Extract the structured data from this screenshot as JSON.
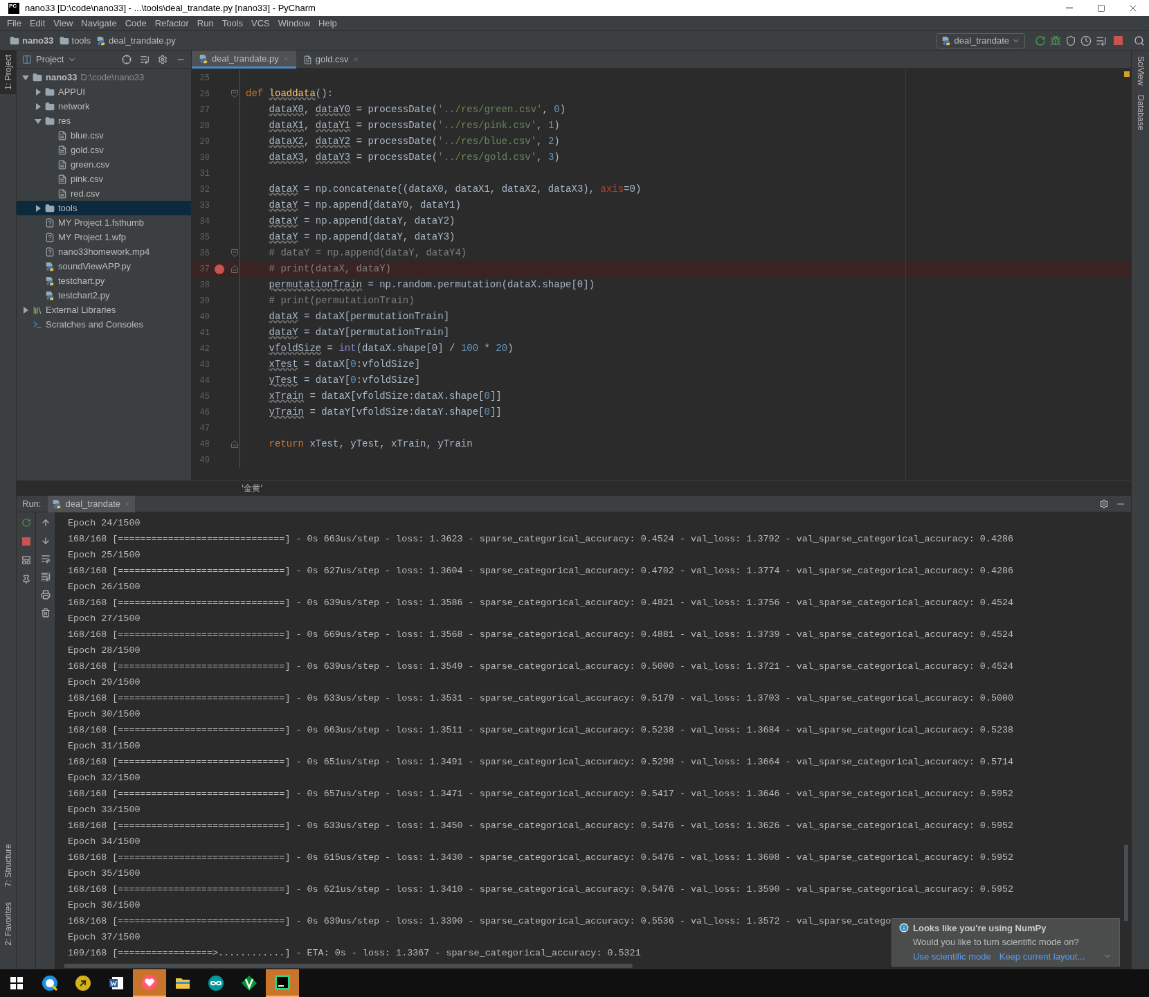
{
  "window": {
    "app_icon_text": "PC",
    "title": "nano33 [D:\\code\\nano33] - ...\\tools\\deal_trandate.py [nano33] - PyCharm"
  },
  "menu": [
    "File",
    "Edit",
    "View",
    "Navigate",
    "Code",
    "Refactor",
    "Run",
    "Tools",
    "VCS",
    "Window",
    "Help"
  ],
  "breadcrumb": [
    {
      "label": "nano33",
      "kind": "project"
    },
    {
      "label": "tools",
      "kind": "folder"
    },
    {
      "label": "deal_trandate.py",
      "kind": "python"
    }
  ],
  "run_config": {
    "label": "deal_trandate"
  },
  "left_stripe": [
    {
      "label": "1: Project",
      "selected": true
    },
    {
      "label": "7: Structure",
      "selected": false
    },
    {
      "label": "2: Favorites",
      "selected": false
    }
  ],
  "right_stripe": [
    "SciView",
    "Database"
  ],
  "project": {
    "title": "Project",
    "tree": [
      {
        "name": "nano33",
        "path": "D:\\code\\nano33",
        "kind": "project",
        "expanded": true,
        "selected": false,
        "children": [
          {
            "name": "APPUI",
            "kind": "module",
            "expanded": false,
            "selected": false
          },
          {
            "name": "network",
            "kind": "module",
            "expanded": false,
            "selected": false
          },
          {
            "name": "res",
            "kind": "module",
            "expanded": true,
            "selected": false,
            "children": [
              {
                "name": "blue.csv",
                "kind": "text",
                "selected": false
              },
              {
                "name": "gold.csv",
                "kind": "text",
                "selected": false
              },
              {
                "name": "green.csv",
                "kind": "text",
                "selected": false
              },
              {
                "name": "pink.csv",
                "kind": "text",
                "selected": false
              },
              {
                "name": "red.csv",
                "kind": "text",
                "selected": false
              }
            ]
          },
          {
            "name": "tools",
            "kind": "module",
            "expanded": false,
            "selected": true
          },
          {
            "name": "MY Project 1.fsthumb",
            "kind": "unknown",
            "selected": false
          },
          {
            "name": "MY Project 1.wfp",
            "kind": "unknown",
            "selected": false
          },
          {
            "name": "nano33homework.mp4",
            "kind": "unknown",
            "selected": false
          },
          {
            "name": "soundViewAPP.py",
            "kind": "python",
            "selected": false
          },
          {
            "name": "testchart.py",
            "kind": "python",
            "selected": false
          },
          {
            "name": "testchart2.py",
            "kind": "python",
            "selected": false
          }
        ]
      },
      {
        "name": "External Libraries",
        "kind": "library",
        "expanded": false,
        "selected": false
      },
      {
        "name": "Scratches and Consoles",
        "kind": "scratches",
        "selected": false
      }
    ]
  },
  "editor": {
    "tabs": [
      {
        "label": "deal_trandate.py",
        "kind": "python",
        "selected": true
      },
      {
        "label": "gold.csv",
        "kind": "text",
        "selected": false
      }
    ],
    "lines": [
      {
        "number": "25",
        "kind": "plain",
        "breakpoint": false
      },
      {
        "number": "26",
        "kind": "foldstart",
        "breakpoint": false,
        "tokens": [
          {
            "text": "def ",
            "kind": "kw"
          },
          {
            "text": "loaddata",
            "kind": "fn"
          },
          {
            "text": "():"
          }
        ],
        "children": [
          {
            "number": "27",
            "kind": "plain",
            "breakpoint": false,
            "tokens": [
              {
                "text": "dataX0",
                "kind": "var"
              },
              {
                "text": ", "
              },
              {
                "text": "dataY0",
                "kind": "var"
              },
              {
                "text": " = processDate("
              },
              {
                "text": "'../res/green.csv'",
                "kind": "str"
              },
              {
                "text": ", "
              },
              {
                "text": "0",
                "kind": "num"
              },
              {
                "text": ")"
              }
            ]
          },
          {
            "number": "28",
            "kind": "plain",
            "breakpoint": false,
            "tokens": [
              {
                "text": "dataX1",
                "kind": "var"
              },
              {
                "text": ", "
              },
              {
                "text": "dataY1",
                "kind": "var"
              },
              {
                "text": " = processDate("
              },
              {
                "text": "'../res/pink.csv'",
                "kind": "str"
              },
              {
                "text": ", "
              },
              {
                "text": "1",
                "kind": "num"
              },
              {
                "text": ")"
              }
            ]
          },
          {
            "number": "29",
            "kind": "plain",
            "breakpoint": false,
            "tokens": [
              {
                "text": "dataX2",
                "kind": "var"
              },
              {
                "text": ", "
              },
              {
                "text": "dataY2",
                "kind": "var"
              },
              {
                "text": " = processDate("
              },
              {
                "text": "'../res/blue.csv'",
                "kind": "str"
              },
              {
                "text": ", "
              },
              {
                "text": "2",
                "kind": "num"
              },
              {
                "text": ")"
              }
            ]
          },
          {
            "number": "30",
            "kind": "plain",
            "breakpoint": false,
            "tokens": [
              {
                "text": "dataX3",
                "kind": "var"
              },
              {
                "text": ", "
              },
              {
                "text": "dataY3",
                "kind": "var"
              },
              {
                "text": " = processDate("
              },
              {
                "text": "'../res/gold.csv'",
                "kind": "str"
              },
              {
                "text": ", "
              },
              {
                "text": "3",
                "kind": "num"
              },
              {
                "text": ")"
              }
            ]
          },
          {
            "number": "31",
            "kind": "plain",
            "breakpoint": false
          },
          {
            "number": "32",
            "kind": "plain",
            "breakpoint": false,
            "tokens": [
              {
                "text": "dataX",
                "kind": "var"
              },
              {
                "text": " = np.concatenate((dataX0, dataX1, dataX2, dataX3), "
              },
              {
                "text": "axis",
                "kind": "param"
              },
              {
                "text": "=0)"
              }
            ]
          },
          {
            "number": "33",
            "kind": "plain",
            "breakpoint": false,
            "tokens": [
              {
                "text": "dataY",
                "kind": "var"
              },
              {
                "text": " = np.append(dataY0, dataY1)"
              }
            ]
          },
          {
            "number": "34",
            "kind": "plain",
            "breakpoint": false,
            "tokens": [
              {
                "text": "dataY",
                "kind": "var"
              },
              {
                "text": " = np.append(dataY, dataY2)"
              }
            ]
          },
          {
            "number": "35",
            "kind": "plain",
            "breakpoint": false,
            "tokens": [
              {
                "text": "dataY",
                "kind": "var"
              },
              {
                "text": " = np.append(dataY, dataY3)"
              }
            ]
          },
          {
            "number": "36",
            "kind": "foldstart",
            "breakpoint": false,
            "tokens": [
              {
                "text": "# dataY = np.append(dataY, dataY4)",
                "kind": "cm"
              }
            ]
          },
          {
            "number": "37",
            "kind": "foldend",
            "breakpoint": true,
            "tokens": [
              {
                "text": "# print(dataX, dataY)",
                "kind": "cm"
              }
            ]
          },
          {
            "number": "38",
            "kind": "plain",
            "breakpoint": false,
            "tokens": [
              {
                "text": "permutationTrain",
                "kind": "var"
              },
              {
                "text": " = np.random.permutation(dataX.shape[0])"
              }
            ]
          },
          {
            "number": "39",
            "kind": "plain",
            "breakpoint": false,
            "tokens": [
              {
                "text": "# print(permutationTrain)",
                "kind": "cm"
              }
            ]
          },
          {
            "number": "40",
            "kind": "plain",
            "breakpoint": false,
            "tokens": [
              {
                "text": "dataX",
                "kind": "var"
              },
              {
                "text": " = dataX[permutationTrain]"
              }
            ]
          },
          {
            "number": "41",
            "kind": "plain",
            "breakpoint": false,
            "tokens": [
              {
                "text": "dataY",
                "kind": "var"
              },
              {
                "text": " = dataY[permutationTrain]"
              }
            ]
          },
          {
            "number": "42",
            "kind": "plain",
            "breakpoint": false,
            "tokens": [
              {
                "text": "vfoldSize",
                "kind": "var"
              },
              {
                "text": " = "
              },
              {
                "text": "int",
                "kind": "builtin"
              },
              {
                "text": "(dataX.shape[0] / "
              },
              {
                "text": "100",
                "kind": "num"
              },
              {
                "text": " * "
              },
              {
                "text": "20",
                "kind": "num"
              },
              {
                "text": ")"
              }
            ]
          },
          {
            "number": "43",
            "kind": "plain",
            "breakpoint": false,
            "tokens": [
              {
                "text": "xTest",
                "kind": "var"
              },
              {
                "text": " = dataX["
              },
              {
                "text": "0",
                "kind": "num"
              },
              {
                "text": ":vfoldSize]"
              }
            ]
          },
          {
            "number": "44",
            "kind": "plain",
            "breakpoint": false,
            "tokens": [
              {
                "text": "yTest",
                "kind": "var"
              },
              {
                "text": " = dataY["
              },
              {
                "text": "0",
                "kind": "num"
              },
              {
                "text": ":vfoldSize]"
              }
            ]
          },
          {
            "number": "45",
            "kind": "plain",
            "breakpoint": false,
            "tokens": [
              {
                "text": "xTrain",
                "kind": "var"
              },
              {
                "text": " = dataX[vfoldSize:dataX.shape["
              },
              {
                "text": "0",
                "kind": "num"
              },
              {
                "text": "]]"
              }
            ]
          },
          {
            "number": "46",
            "kind": "plain",
            "breakpoint": false,
            "tokens": [
              {
                "text": "yTrain",
                "kind": "var"
              },
              {
                "text": " = dataY[vfoldSize:dataY.shape["
              },
              {
                "text": "0",
                "kind": "num"
              },
              {
                "text": "]]"
              }
            ]
          },
          {
            "number": "47",
            "kind": "plain",
            "breakpoint": false
          },
          {
            "number": "48",
            "kind": "foldend",
            "breakpoint": false,
            "tokens": [
              {
                "text": "return",
                "kind": "kw"
              },
              {
                "text": " xTest, yTest, xTrain, yTrain"
              }
            ]
          }
        ]
      },
      {
        "number": "49",
        "kind": "plain",
        "breakpoint": false
      }
    ],
    "status": "'金黄'"
  },
  "run": {
    "label": "Run:",
    "tab": "deal_trandate",
    "lines": [
      "Epoch 24/1500",
      "168/168 [==============================] - 0s 663us/step - loss: 1.3623 - sparse_categorical_accuracy: 0.4524 - val_loss: 1.3792 - val_sparse_categorical_accuracy: 0.4286",
      "Epoch 25/1500",
      "168/168 [==============================] - 0s 627us/step - loss: 1.3604 - sparse_categorical_accuracy: 0.4702 - val_loss: 1.3774 - val_sparse_categorical_accuracy: 0.4286",
      "Epoch 26/1500",
      "168/168 [==============================] - 0s 639us/step - loss: 1.3586 - sparse_categorical_accuracy: 0.4821 - val_loss: 1.3756 - val_sparse_categorical_accuracy: 0.4524",
      "Epoch 27/1500",
      "168/168 [==============================] - 0s 669us/step - loss: 1.3568 - sparse_categorical_accuracy: 0.4881 - val_loss: 1.3739 - val_sparse_categorical_accuracy: 0.4524",
      "Epoch 28/1500",
      "168/168 [==============================] - 0s 639us/step - loss: 1.3549 - sparse_categorical_accuracy: 0.5000 - val_loss: 1.3721 - val_sparse_categorical_accuracy: 0.4524",
      "Epoch 29/1500",
      "168/168 [==============================] - 0s 633us/step - loss: 1.3531 - sparse_categorical_accuracy: 0.5179 - val_loss: 1.3703 - val_sparse_categorical_accuracy: 0.5000",
      "Epoch 30/1500",
      "168/168 [==============================] - 0s 663us/step - loss: 1.3511 - sparse_categorical_accuracy: 0.5238 - val_loss: 1.3684 - val_sparse_categorical_accuracy: 0.5238",
      "Epoch 31/1500",
      "168/168 [==============================] - 0s 651us/step - loss: 1.3491 - sparse_categorical_accuracy: 0.5298 - val_loss: 1.3664 - val_sparse_categorical_accuracy: 0.5714",
      "Epoch 32/1500",
      "168/168 [==============================] - 0s 657us/step - loss: 1.3471 - sparse_categorical_accuracy: 0.5417 - val_loss: 1.3646 - val_sparse_categorical_accuracy: 0.5952",
      "Epoch 33/1500",
      "168/168 [==============================] - 0s 633us/step - loss: 1.3450 - sparse_categorical_accuracy: 0.5476 - val_loss: 1.3626 - val_sparse_categorical_accuracy: 0.5952",
      "Epoch 34/1500",
      "168/168 [==============================] - 0s 615us/step - loss: 1.3430 - sparse_categorical_accuracy: 0.5476 - val_loss: 1.3608 - val_sparse_categorical_accuracy: 0.5952",
      "Epoch 35/1500",
      "168/168 [==============================] - 0s 621us/step - loss: 1.3410 - sparse_categorical_accuracy: 0.5476 - val_loss: 1.3590 - val_sparse_categorical_accuracy: 0.5952",
      "Epoch 36/1500",
      "168/168 [==============================] - 0s 639us/step - loss: 1.3390 - sparse_categorical_accuracy: 0.5536 - val_loss: 1.3572 - val_sparse_catego",
      "Epoch 37/1500",
      "109/168 [=================>............] - ETA: 0s - loss: 1.3367 - sparse_categorical_accuracy: 0.5321"
    ]
  },
  "notification": {
    "title": "Looks like you're using NumPy",
    "body": "Would you like to turn scientific mode on?",
    "links": [
      "Use scientific mode",
      "Keep current layout..."
    ]
  },
  "taskbar": [
    {
      "kind": "windows",
      "active": false
    },
    {
      "kind": "browser",
      "active": false
    },
    {
      "kind": "bulb",
      "active": false
    },
    {
      "kind": "word",
      "active": false
    },
    {
      "kind": "heart",
      "active": true
    },
    {
      "kind": "explorer",
      "active": false
    },
    {
      "kind": "infinity",
      "active": false
    },
    {
      "kind": "vim",
      "active": false
    },
    {
      "kind": "ide",
      "active": true
    }
  ]
}
